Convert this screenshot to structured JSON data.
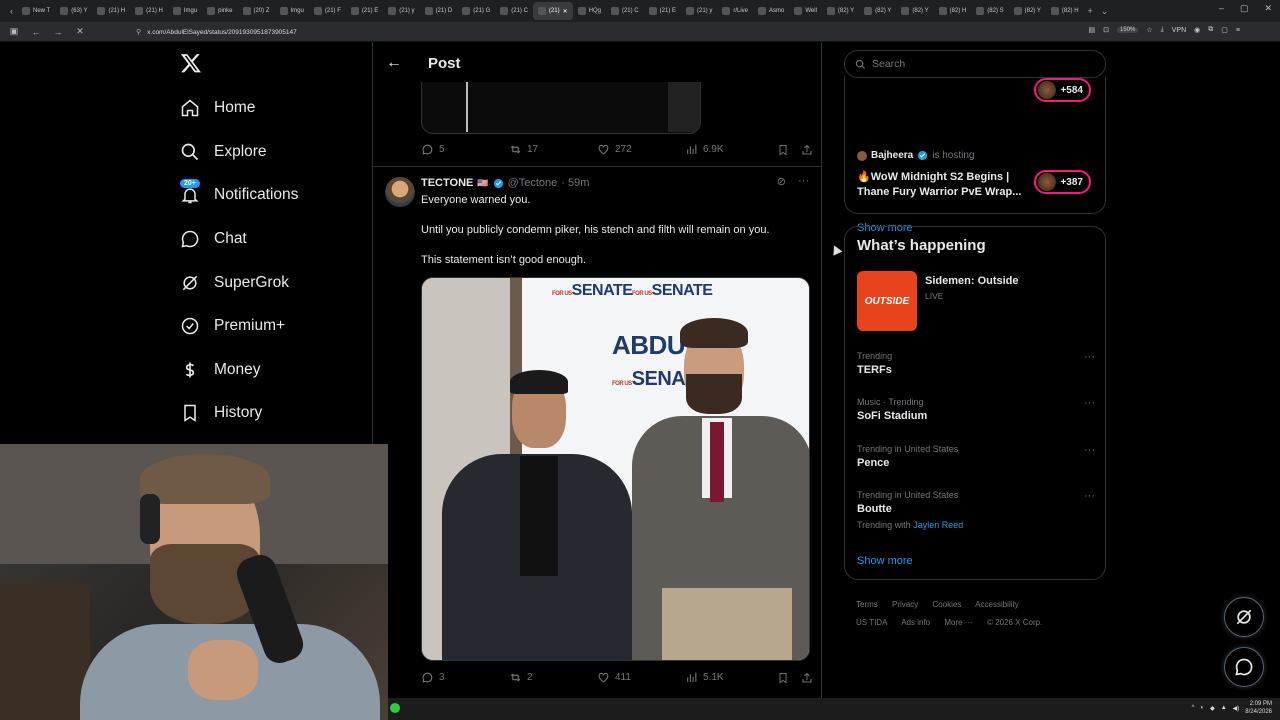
{
  "browser": {
    "tabs": [
      {
        "label": "New T"
      },
      {
        "label": "(63) Y"
      },
      {
        "label": "(21) H"
      },
      {
        "label": "(21) H"
      },
      {
        "label": "Imgu"
      },
      {
        "label": "pinke"
      },
      {
        "label": "(20) Z"
      },
      {
        "label": "Imgu"
      },
      {
        "label": "(21) F"
      },
      {
        "label": "(21) E"
      },
      {
        "label": "(21) y"
      },
      {
        "label": "(21) D"
      },
      {
        "label": "(21) G"
      },
      {
        "label": "(21) C"
      },
      {
        "label": "(21)",
        "active": true
      },
      {
        "label": "HQg"
      },
      {
        "label": "(21) C"
      },
      {
        "label": "(21) E"
      },
      {
        "label": "(21) y"
      },
      {
        "label": "r/Live"
      },
      {
        "label": "Asmo"
      },
      {
        "label": "Well"
      },
      {
        "label": "(82) Y"
      },
      {
        "label": "(82) Y"
      },
      {
        "label": "(82) Y"
      },
      {
        "label": "(82) H"
      },
      {
        "label": "(82) S"
      },
      {
        "label": "(82) Y"
      },
      {
        "label": "(82) H"
      }
    ],
    "url": "x.com/AbdulElSayed/status/2091930951873905147",
    "zoom": "150%",
    "vpn": "VPN"
  },
  "nav": {
    "items": [
      {
        "label": "Home",
        "icon": "home-icon"
      },
      {
        "label": "Explore",
        "icon": "search-icon"
      },
      {
        "label": "Notifications",
        "icon": "bell-icon",
        "badge": "20+"
      },
      {
        "label": "Chat",
        "icon": "chat-icon"
      },
      {
        "label": "SuperGrok",
        "icon": "grok-icon"
      },
      {
        "label": "Premium+",
        "icon": "premium-icon"
      },
      {
        "label": "Money",
        "icon": "money-icon"
      },
      {
        "label": "History",
        "icon": "bookmark-icon"
      }
    ]
  },
  "post_header": {
    "title": "Post"
  },
  "prev_actions": {
    "replies": "5",
    "reposts": "17",
    "likes": "272",
    "views": "6.9K"
  },
  "tweet": {
    "name": "TECTONE",
    "flag": "🇺🇸",
    "handle": "@Tectone",
    "time": "· 59m",
    "lines": [
      "Everyone warned you.",
      "Until you publicly condemn piker, his stench and filth will remain on you.",
      "This statement isn’t good enough."
    ],
    "media_banner_title": "ABDUL",
    "media_banner_for": "FOR US",
    "media_banner_word": "SENATE",
    "actions": {
      "replies": "3",
      "reposts": "2",
      "likes": "411",
      "views": "5.1K"
    }
  },
  "right": {
    "search_placeholder": "Search",
    "top_pill_count": "+584",
    "host_name": "Bajheera",
    "host_note": "is hosting",
    "space_title": "🔥WoW Midnight S2 Begins | Thane Fury Warrior PvE Wrap...",
    "space_pill_count": "+387",
    "show_more_1": "Show more",
    "happening_title": "What’s happening",
    "live": {
      "title": "Sidemen: Outside",
      "status": "LIVE",
      "thumb_text": "OUTSIDE"
    },
    "trends": [
      {
        "context": "Trending",
        "topic": "TERFs"
      },
      {
        "context": "Music · Trending",
        "topic": "SoFi Stadium"
      },
      {
        "context": "Trending in United States",
        "topic": "Pence"
      },
      {
        "context": "Trending in United States",
        "topic": "Boutte",
        "with_label": "Trending with",
        "with_name": "Jaylen Reed"
      }
    ],
    "show_more_2": "Show more",
    "footer": {
      "terms": "Terms",
      "privacy": "Privacy",
      "cookies": "Cookies",
      "accessibility": "Accessibility",
      "ustida": "US TIDA",
      "ads": "Ads info",
      "more": "More ···",
      "copyright": "© 2026 X Corp."
    }
  },
  "taskbar": {
    "time": "2:09 PM",
    "date": "8/24/2026"
  },
  "colors": {
    "accent": "#1d9bf0",
    "border": "#2f3336",
    "muted": "#71767b",
    "live_pink": "#f91880"
  }
}
